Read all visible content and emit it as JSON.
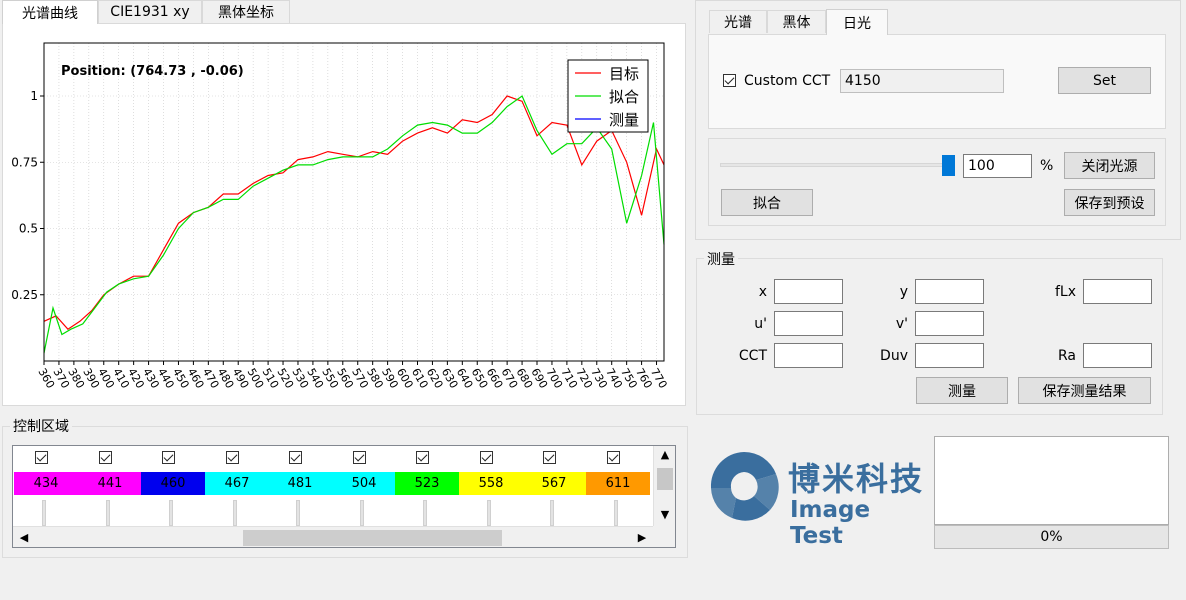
{
  "left_tabs": [
    {
      "label": "光谱曲线",
      "active": true
    },
    {
      "label": "CIE1931 xy",
      "active": false
    },
    {
      "label": "黑体坐标",
      "active": false
    }
  ],
  "right_tabs": [
    {
      "label": "光谱",
      "active": false
    },
    {
      "label": "黑体",
      "active": false
    },
    {
      "label": "日光",
      "active": true
    }
  ],
  "chart": {
    "position_text": "Position: (764.73 , -0.06)",
    "legend": [
      {
        "name": "目标",
        "color": "#ff0000"
      },
      {
        "name": "拟合",
        "color": "#00dd00"
      },
      {
        "name": "测量",
        "color": "#0000ff"
      }
    ]
  },
  "chart_data": {
    "type": "line",
    "xlim": [
      360,
      775
    ],
    "ylim": [
      0,
      1.2
    ],
    "yticks": [
      0.25,
      0.5,
      0.75,
      1
    ],
    "ytick_labels": [
      "0.25",
      "0.5",
      "0.75",
      "1"
    ],
    "xticks": [
      360,
      370,
      380,
      390,
      400,
      410,
      420,
      430,
      440,
      450,
      460,
      470,
      480,
      490,
      500,
      510,
      520,
      530,
      540,
      550,
      560,
      570,
      580,
      590,
      600,
      610,
      620,
      630,
      640,
      650,
      660,
      670,
      680,
      690,
      700,
      710,
      720,
      730,
      740,
      750,
      760,
      770
    ],
    "grid": true,
    "legend_position": "top-right",
    "series": [
      {
        "name": "目标",
        "color": "#ff0000",
        "x": [
          360,
          368,
          376,
          384,
          392,
          400,
          410,
          420,
          430,
          440,
          450,
          460,
          470,
          480,
          490,
          500,
          510,
          520,
          530,
          540,
          550,
          560,
          570,
          580,
          590,
          600,
          610,
          620,
          630,
          640,
          650,
          660,
          670,
          680,
          690,
          700,
          710,
          720,
          730,
          740,
          750,
          760,
          770,
          775
        ],
        "y": [
          0.15,
          0.17,
          0.12,
          0.15,
          0.19,
          0.25,
          0.29,
          0.32,
          0.32,
          0.42,
          0.52,
          0.56,
          0.58,
          0.63,
          0.63,
          0.67,
          0.7,
          0.71,
          0.76,
          0.77,
          0.79,
          0.78,
          0.77,
          0.79,
          0.78,
          0.83,
          0.86,
          0.88,
          0.86,
          0.91,
          0.9,
          0.93,
          1.0,
          0.98,
          0.85,
          0.9,
          0.89,
          0.74,
          0.83,
          0.87,
          0.75,
          0.55,
          0.8,
          0.74
        ]
      },
      {
        "name": "拟合",
        "color": "#00dd00",
        "x": [
          360,
          366,
          372,
          378,
          386,
          394,
          402,
          410,
          420,
          430,
          440,
          450,
          460,
          470,
          480,
          490,
          500,
          510,
          520,
          530,
          540,
          550,
          560,
          570,
          580,
          590,
          600,
          610,
          620,
          630,
          640,
          650,
          660,
          670,
          680,
          690,
          700,
          710,
          720,
          730,
          740,
          750,
          760,
          768,
          775
        ],
        "y": [
          0.03,
          0.2,
          0.1,
          0.12,
          0.14,
          0.2,
          0.26,
          0.29,
          0.31,
          0.32,
          0.4,
          0.5,
          0.56,
          0.58,
          0.61,
          0.61,
          0.66,
          0.69,
          0.72,
          0.74,
          0.74,
          0.76,
          0.77,
          0.77,
          0.77,
          0.8,
          0.85,
          0.89,
          0.9,
          0.89,
          0.86,
          0.86,
          0.9,
          0.96,
          1.0,
          0.87,
          0.78,
          0.82,
          0.82,
          0.88,
          0.8,
          0.52,
          0.7,
          0.9,
          0.44
        ]
      },
      {
        "name": "测量",
        "color": "#0000ff",
        "x": [],
        "y": []
      }
    ]
  },
  "control_area": {
    "title": "控制区域",
    "channels": [
      {
        "label": "434",
        "color": "#ff00ff",
        "checked": true
      },
      {
        "label": "441",
        "color": "#ff00ff",
        "checked": true
      },
      {
        "label": "460",
        "color": "#0000ee",
        "checked": true
      },
      {
        "label": "467",
        "color": "#00ffff",
        "checked": true
      },
      {
        "label": "481",
        "color": "#00ffff",
        "checked": true
      },
      {
        "label": "504",
        "color": "#00ffff",
        "checked": true
      },
      {
        "label": "523",
        "color": "#00ff00",
        "checked": true
      },
      {
        "label": "558",
        "color": "#ffff00",
        "checked": true
      },
      {
        "label": "567",
        "color": "#ffff00",
        "checked": true
      },
      {
        "label": "611",
        "color": "#ff9900",
        "checked": true
      }
    ],
    "scroll_left": "<",
    "scroll_right": ">",
    "scroll_up": "^",
    "scroll_down": "v"
  },
  "daylight": {
    "custom_cct_label": "Custom CCT",
    "custom_cct_checked": true,
    "cct_value": "4150",
    "set_label": "Set"
  },
  "output": {
    "slider_value": 100,
    "intensity_value": "100",
    "percent": "%",
    "close_label": "关闭光源",
    "fit_label": "拟合",
    "save_preset_label": "保存到预设"
  },
  "measure": {
    "title": "测量",
    "labels": {
      "x": "x",
      "y": "y",
      "flx": "fLx",
      "u": "u'",
      "v": "v'",
      "cct": "CCT",
      "duv": "Duv",
      "ra": "Ra"
    },
    "values": {
      "x": "",
      "y": "",
      "flx": "",
      "u": "",
      "v": "",
      "cct": "",
      "duv": "",
      "ra": ""
    },
    "measure_label": "测量",
    "save_result_label": "保存测量结果"
  },
  "logo": {
    "name_cn": "博米科技",
    "name_en": "Image Test",
    "color": "#3a6e9e"
  },
  "progress": {
    "value": 0,
    "text": "0%"
  }
}
